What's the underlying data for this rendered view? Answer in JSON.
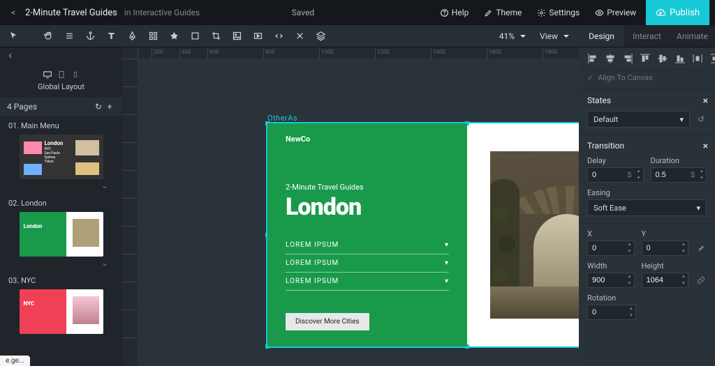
{
  "top": {
    "back": "<",
    "title": "2-Minute Travel Guides",
    "subtitle": "in Interactive Guides",
    "saved": "Saved",
    "help": "Help",
    "theme": "Theme",
    "settings": "Settings",
    "preview": "Preview",
    "publish": "Publish"
  },
  "toolbar": {
    "zoom": "41%",
    "view": "View"
  },
  "rightTabs": {
    "design": "Design",
    "interact": "Interact",
    "animate": "Animate"
  },
  "sidebar": {
    "globalLayout": "Global Layout",
    "pagesLabel": "4 Pages",
    "pages": [
      {
        "num": "01.",
        "name": "Main Menu"
      },
      {
        "num": "02.",
        "name": "London"
      },
      {
        "num": "03.",
        "name": "NYC"
      }
    ]
  },
  "canvas": {
    "selectedLabel": "OtherAs",
    "rulerTicks": [
      "200",
      "400",
      "600",
      "800",
      "1000",
      "1200",
      "1400",
      "1600",
      "1800"
    ],
    "page": {
      "logo": "NewCo",
      "subtitle": "2-Minute Travel Guides",
      "heading": "London",
      "accordion": [
        "LOREM IPSUM",
        "LOREM IPSUM",
        "LOREM IPSUM"
      ],
      "cta": "Discover More Cities"
    }
  },
  "inspector": {
    "alignToCanvas": "Align To Canvas",
    "states": {
      "title": "States",
      "value": "Default"
    },
    "transition": {
      "title": "Transition",
      "delayLabel": "Delay",
      "delay": "0",
      "durationLabel": "Duration",
      "duration": "0.5",
      "unit": "S",
      "easingLabel": "Easing",
      "easing": "Soft Ease"
    },
    "geom": {
      "xLabel": "X",
      "x": "0",
      "yLabel": "Y",
      "y": "0",
      "wLabel": "Width",
      "w": "900",
      "hLabel": "Height",
      "h": "1064",
      "rotLabel": "Rotation",
      "rot": "0"
    }
  },
  "footerTab": "e.ge..."
}
